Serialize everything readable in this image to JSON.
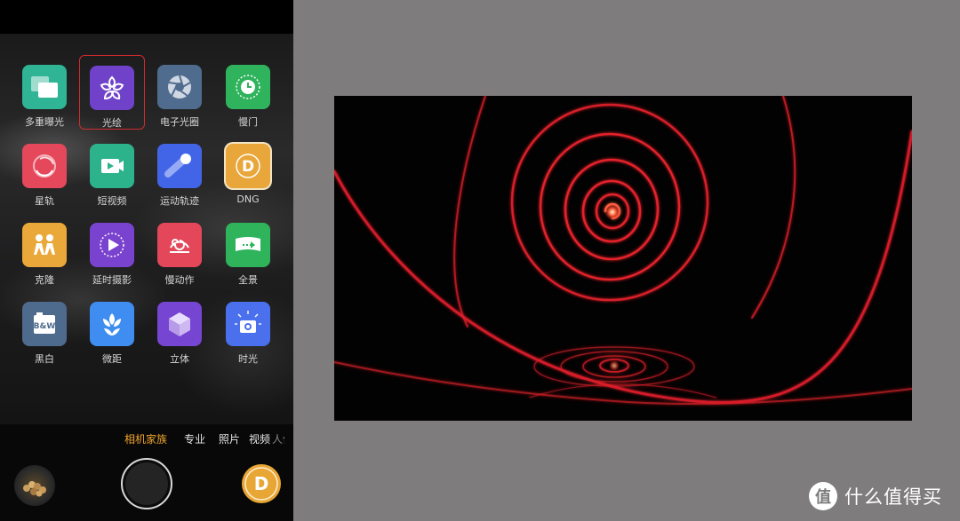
{
  "camera": {
    "modes": [
      {
        "id": "multi-exposure",
        "label": "多重曝光",
        "color": "#2fb495",
        "icon": "multi-exposure-icon"
      },
      {
        "id": "light-painting",
        "label": "光绘",
        "color": "#6f42c9",
        "icon": "flower-icon",
        "selected": true
      },
      {
        "id": "aperture",
        "label": "电子光圈",
        "color": "#4f6c8e",
        "icon": "aperture-icon"
      },
      {
        "id": "slow-shutter",
        "label": "慢门",
        "color": "#2fb35c",
        "icon": "clock-icon"
      },
      {
        "id": "star-trail",
        "label": "星轨",
        "color": "#e5485a",
        "icon": "star-trail-icon"
      },
      {
        "id": "short-video",
        "label": "短视频",
        "color": "#2db38c",
        "icon": "video-camera-icon"
      },
      {
        "id": "motion-trail",
        "label": "运动轨迹",
        "color": "#4265e8",
        "icon": "motion-trail-icon"
      },
      {
        "id": "dng",
        "label": "DNG",
        "color": "#e9a63a",
        "icon": "dng-icon",
        "letter": "D"
      },
      {
        "id": "clone",
        "label": "克隆",
        "color": "#eaa83a",
        "icon": "clone-people-icon"
      },
      {
        "id": "timelapse",
        "label": "延时摄影",
        "color": "#7a43cf",
        "icon": "timelapse-play-icon"
      },
      {
        "id": "slow-motion",
        "label": "慢动作",
        "color": "#e4475a",
        "icon": "slow-motion-icon"
      },
      {
        "id": "panorama",
        "label": "全景",
        "color": "#2fb45c",
        "icon": "panorama-icon"
      },
      {
        "id": "black-white",
        "label": "黑白",
        "color": "#4e6a8c",
        "icon": "bw-icon",
        "letter": "B&W"
      },
      {
        "id": "macro",
        "label": "微距",
        "color": "#3f8df0",
        "icon": "tulip-icon"
      },
      {
        "id": "3d",
        "label": "立体",
        "color": "#7645d2",
        "icon": "cube-icon"
      },
      {
        "id": "time-light",
        "label": "时光",
        "color": "#4a70ee",
        "icon": "camera-sparkle-icon"
      }
    ],
    "tabs": [
      {
        "label": "相机家族",
        "active": true
      },
      {
        "label": "专业"
      },
      {
        "label": "照片"
      },
      {
        "label": "视频"
      },
      {
        "label": "人像"
      }
    ],
    "dng_button_letter": "D"
  },
  "watermark": {
    "logo": "值",
    "text": "什么值得买"
  }
}
